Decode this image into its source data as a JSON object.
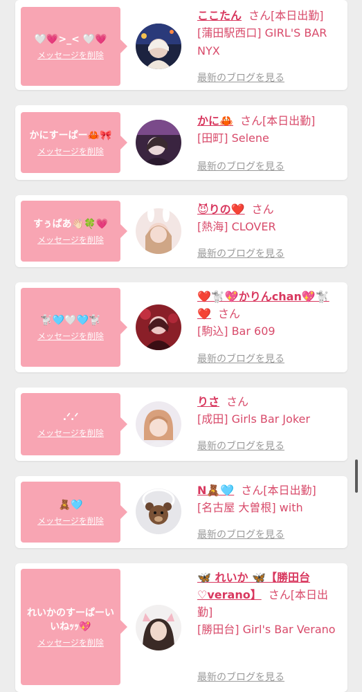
{
  "delete_label": "メッセージを削除",
  "blog_label": "最新のブログを見る",
  "cards": [
    {
      "message": "🤍💗>_< 🤍💗",
      "name": "ここたん",
      "suffix": "さん[本日出勤]",
      "shop": "[蒲田駅西口] GIRL'S BAR NYX",
      "avatar_icon": "night-city-portrait"
    },
    {
      "message": "かにすーぱー🦀🎀",
      "name": "かに🦀",
      "suffix": "さん[本日出勤]",
      "shop": "[田町] Selene",
      "avatar_icon": "dark-room-portrait"
    },
    {
      "message": "すぅぱあ👋🏻🍀💗",
      "name": "😈りの❤️",
      "suffix": "さん",
      "shop": "[熱海] CLOVER",
      "avatar_icon": "bunny-ears-portrait"
    },
    {
      "message": "🐩🩵🤍🩵🐩",
      "name": "❤️🐩💖かりんchan💖🐩❤️",
      "suffix": "さん",
      "shop": "[駒込] Bar 609",
      "avatar_icon": "red-rose-portrait"
    },
    {
      "message": ".ᐟ.ᐟ",
      "name": "りさ",
      "suffix": "さん",
      "shop": "[成田] Girls Bar Joker",
      "avatar_icon": "bob-hair-portrait"
    },
    {
      "message": "🧸🩵",
      "name": "N🧸🩵",
      "suffix": "さん[本日出勤]",
      "shop": "[名古屋 大曽根] with",
      "avatar_icon": "teddy-bear-portrait"
    },
    {
      "message": "れいかのすーぱーいいねｯｯ💖",
      "name": "🦋 れいか 🦋【勝田台♡verano】",
      "suffix": "さん[本日出勤]",
      "shop": "[勝田台] Girl's Bar Verano",
      "avatar_icon": "cat-ears-portrait"
    }
  ]
}
